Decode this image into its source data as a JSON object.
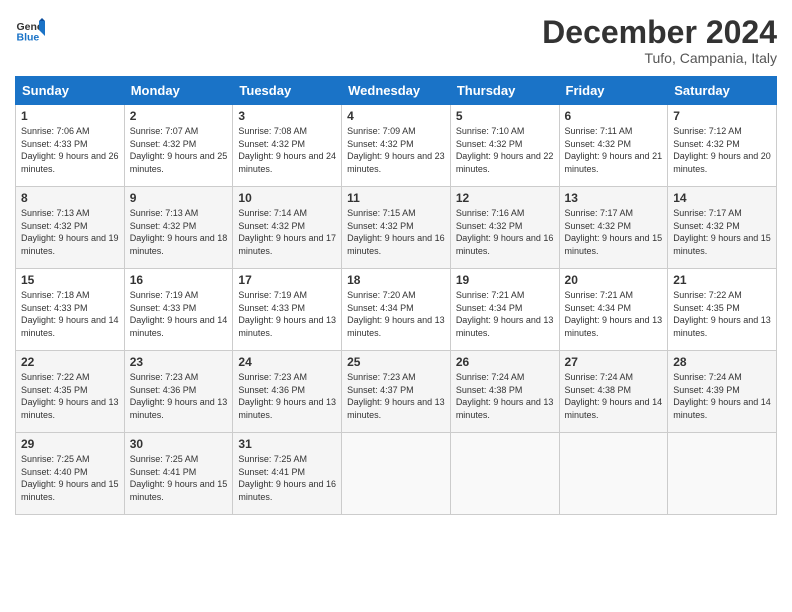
{
  "header": {
    "logo_general": "General",
    "logo_blue": "Blue",
    "month_title": "December 2024",
    "location": "Tufo, Campania, Italy"
  },
  "calendar": {
    "headers": [
      "Sunday",
      "Monday",
      "Tuesday",
      "Wednesday",
      "Thursday",
      "Friday",
      "Saturday"
    ],
    "rows": [
      [
        {
          "day": "1",
          "sunrise": "7:06 AM",
          "sunset": "4:33 PM",
          "daylight": "9 hours and 26 minutes."
        },
        {
          "day": "2",
          "sunrise": "7:07 AM",
          "sunset": "4:32 PM",
          "daylight": "9 hours and 25 minutes."
        },
        {
          "day": "3",
          "sunrise": "7:08 AM",
          "sunset": "4:32 PM",
          "daylight": "9 hours and 24 minutes."
        },
        {
          "day": "4",
          "sunrise": "7:09 AM",
          "sunset": "4:32 PM",
          "daylight": "9 hours and 23 minutes."
        },
        {
          "day": "5",
          "sunrise": "7:10 AM",
          "sunset": "4:32 PM",
          "daylight": "9 hours and 22 minutes."
        },
        {
          "day": "6",
          "sunrise": "7:11 AM",
          "sunset": "4:32 PM",
          "daylight": "9 hours and 21 minutes."
        },
        {
          "day": "7",
          "sunrise": "7:12 AM",
          "sunset": "4:32 PM",
          "daylight": "9 hours and 20 minutes."
        }
      ],
      [
        {
          "day": "8",
          "sunrise": "7:13 AM",
          "sunset": "4:32 PM",
          "daylight": "9 hours and 19 minutes."
        },
        {
          "day": "9",
          "sunrise": "7:13 AM",
          "sunset": "4:32 PM",
          "daylight": "9 hours and 18 minutes."
        },
        {
          "day": "10",
          "sunrise": "7:14 AM",
          "sunset": "4:32 PM",
          "daylight": "9 hours and 17 minutes."
        },
        {
          "day": "11",
          "sunrise": "7:15 AM",
          "sunset": "4:32 PM",
          "daylight": "9 hours and 16 minutes."
        },
        {
          "day": "12",
          "sunrise": "7:16 AM",
          "sunset": "4:32 PM",
          "daylight": "9 hours and 16 minutes."
        },
        {
          "day": "13",
          "sunrise": "7:17 AM",
          "sunset": "4:32 PM",
          "daylight": "9 hours and 15 minutes."
        },
        {
          "day": "14",
          "sunrise": "7:17 AM",
          "sunset": "4:32 PM",
          "daylight": "9 hours and 15 minutes."
        }
      ],
      [
        {
          "day": "15",
          "sunrise": "7:18 AM",
          "sunset": "4:33 PM",
          "daylight": "9 hours and 14 minutes."
        },
        {
          "day": "16",
          "sunrise": "7:19 AM",
          "sunset": "4:33 PM",
          "daylight": "9 hours and 14 minutes."
        },
        {
          "day": "17",
          "sunrise": "7:19 AM",
          "sunset": "4:33 PM",
          "daylight": "9 hours and 13 minutes."
        },
        {
          "day": "18",
          "sunrise": "7:20 AM",
          "sunset": "4:34 PM",
          "daylight": "9 hours and 13 minutes."
        },
        {
          "day": "19",
          "sunrise": "7:21 AM",
          "sunset": "4:34 PM",
          "daylight": "9 hours and 13 minutes."
        },
        {
          "day": "20",
          "sunrise": "7:21 AM",
          "sunset": "4:34 PM",
          "daylight": "9 hours and 13 minutes."
        },
        {
          "day": "21",
          "sunrise": "7:22 AM",
          "sunset": "4:35 PM",
          "daylight": "9 hours and 13 minutes."
        }
      ],
      [
        {
          "day": "22",
          "sunrise": "7:22 AM",
          "sunset": "4:35 PM",
          "daylight": "9 hours and 13 minutes."
        },
        {
          "day": "23",
          "sunrise": "7:23 AM",
          "sunset": "4:36 PM",
          "daylight": "9 hours and 13 minutes."
        },
        {
          "day": "24",
          "sunrise": "7:23 AM",
          "sunset": "4:36 PM",
          "daylight": "9 hours and 13 minutes."
        },
        {
          "day": "25",
          "sunrise": "7:23 AM",
          "sunset": "4:37 PM",
          "daylight": "9 hours and 13 minutes."
        },
        {
          "day": "26",
          "sunrise": "7:24 AM",
          "sunset": "4:38 PM",
          "daylight": "9 hours and 13 minutes."
        },
        {
          "day": "27",
          "sunrise": "7:24 AM",
          "sunset": "4:38 PM",
          "daylight": "9 hours and 14 minutes."
        },
        {
          "day": "28",
          "sunrise": "7:24 AM",
          "sunset": "4:39 PM",
          "daylight": "9 hours and 14 minutes."
        }
      ],
      [
        {
          "day": "29",
          "sunrise": "7:25 AM",
          "sunset": "4:40 PM",
          "daylight": "9 hours and 15 minutes."
        },
        {
          "day": "30",
          "sunrise": "7:25 AM",
          "sunset": "4:41 PM",
          "daylight": "9 hours and 15 minutes."
        },
        {
          "day": "31",
          "sunrise": "7:25 AM",
          "sunset": "4:41 PM",
          "daylight": "9 hours and 16 minutes."
        },
        null,
        null,
        null,
        null
      ]
    ]
  }
}
